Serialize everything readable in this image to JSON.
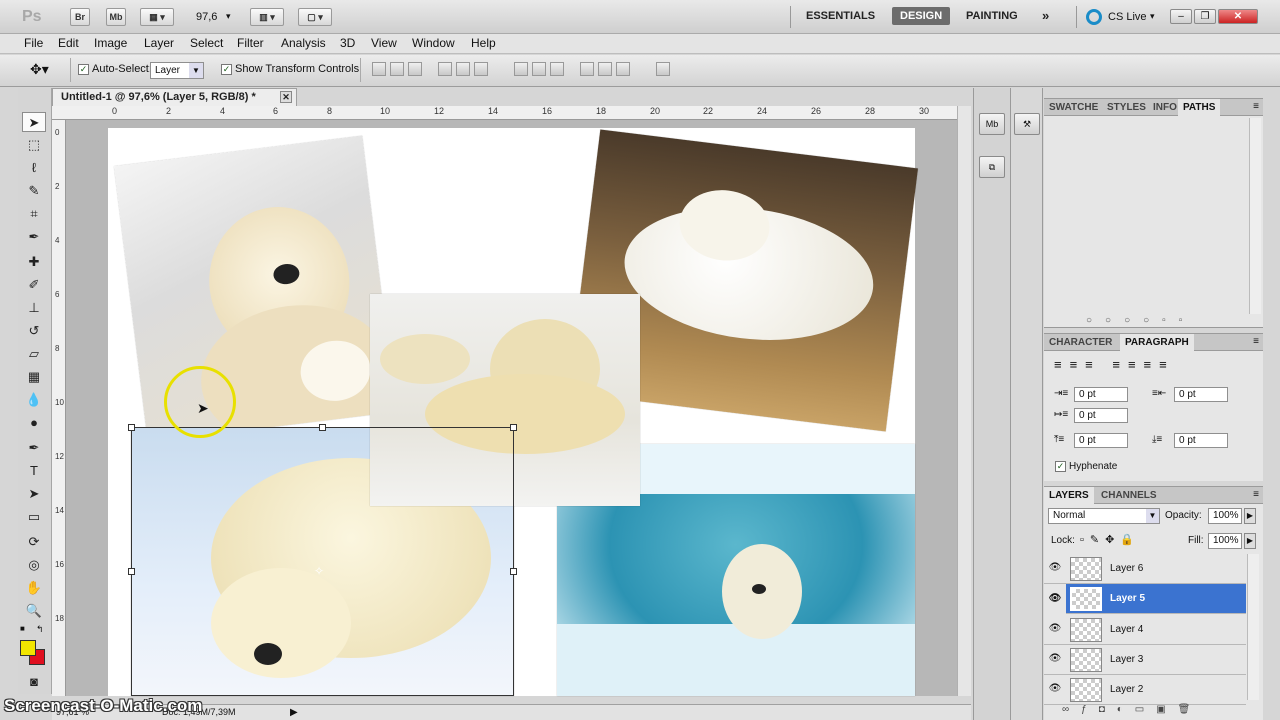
{
  "app": {
    "logo": "Ps",
    "bridge_btn": "Br",
    "minibridge_btn": "Mb",
    "zoom": "97,6",
    "workspaces": [
      "ESSENTIALS",
      "DESIGN",
      "PAINTING"
    ],
    "active_workspace": "DESIGN",
    "cslive": "CS Live",
    "more": "»"
  },
  "menu": [
    "File",
    "Edit",
    "Image",
    "Layer",
    "Select",
    "Filter",
    "Analysis",
    "3D",
    "View",
    "Window",
    "Help"
  ],
  "options": {
    "auto_select_label": "Auto-Select:",
    "auto_select_value": "Layer",
    "transform_label": "Show Transform Controls"
  },
  "document": {
    "tab_title": "Untitled-1 @ 97,6% (Layer 5, RGB/8) *",
    "ruler_top": [
      "0",
      "2",
      "4",
      "6",
      "8",
      "10",
      "12",
      "14",
      "16",
      "18",
      "20",
      "22",
      "24",
      "26",
      "28",
      "30"
    ],
    "ruler_left": [
      "0",
      "2",
      "4",
      "6",
      "8",
      "10",
      "12",
      "14",
      "16",
      "18"
    ],
    "status_zoom": "97,61 %",
    "status_doc": "Doc: 1,49M/7,39M"
  },
  "panels": {
    "top_tabs": [
      "SWATCHE",
      "STYLES",
      "INFO",
      "PATHS"
    ],
    "top_active": "PATHS",
    "mid_tabs": [
      "CHARACTER",
      "PARAGRAPH"
    ],
    "mid_active": "PARAGRAPH",
    "indent_left": "0 pt",
    "indent_right": "0 pt",
    "indent_first": "0 pt",
    "space_before": "0 pt",
    "space_after": "0 pt",
    "hyphenate": "Hyphenate"
  },
  "layers_panel": {
    "tabs": [
      "LAYERS",
      "CHANNELS"
    ],
    "active_tab": "LAYERS",
    "blend_mode": "Normal",
    "opacity_label": "Opacity:",
    "opacity": "100%",
    "lock_label": "Lock:",
    "fill_label": "Fill:",
    "fill": "100%",
    "layers": [
      {
        "name": "Layer 6",
        "selected": false
      },
      {
        "name": "Layer 5",
        "selected": true
      },
      {
        "name": "Layer 4",
        "selected": false
      },
      {
        "name": "Layer 3",
        "selected": false
      },
      {
        "name": "Layer 2",
        "selected": false
      }
    ]
  },
  "watermark": "Screencast-O-Matic.com",
  "colors": {
    "foreground": "#f2e600",
    "background": "#e01020",
    "selection": "#3b73d0",
    "cursor_ring": "#e8e000"
  }
}
